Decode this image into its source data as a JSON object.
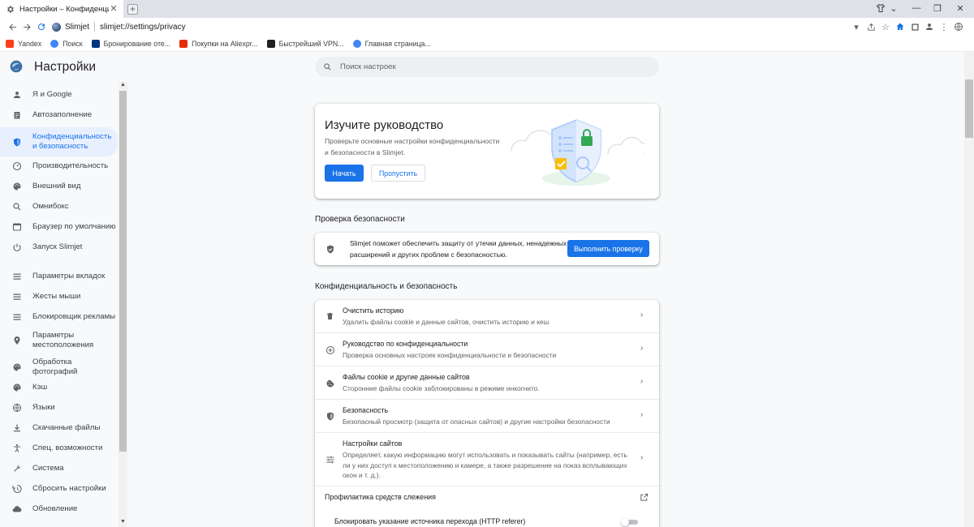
{
  "browser": {
    "tab_title": "Настройки – Конфиденциальность",
    "omnibox": {
      "site": "Slimjet",
      "url": "slimjet://settings/privacy"
    },
    "bookmarks": [
      {
        "label": "Yandex",
        "color": "#fc3f1d"
      },
      {
        "label": "Поиск",
        "color": "#4285f4"
      },
      {
        "label": "Бронирование оте...",
        "color": "#003580"
      },
      {
        "label": "Покупки на Aliexpr...",
        "color": "#e62e04"
      },
      {
        "label": "Быстрейший VPN...",
        "color": "#202124"
      },
      {
        "label": "Главная страница...",
        "color": "#4285f4"
      }
    ]
  },
  "page": {
    "title": "Настройки",
    "search_placeholder": "Поиск настроек"
  },
  "sidebar": {
    "items": [
      {
        "label": "Я и Google",
        "icon": "person-icon"
      },
      {
        "label": "Автозаполнение",
        "icon": "clipboard-icon"
      },
      {
        "label": "Конфиденциальность и безопасность",
        "icon": "shield-icon",
        "active": true
      },
      {
        "label": "Производительность",
        "icon": "speedometer-icon"
      },
      {
        "label": "Внешний вид",
        "icon": "palette-icon"
      },
      {
        "label": "Омнибокс",
        "icon": "search-icon"
      },
      {
        "label": "Браузер по умолчанию",
        "icon": "browser-icon"
      },
      {
        "label": "Запуск Slimjet",
        "icon": "power-icon"
      },
      {
        "label": "Параметры вкладок",
        "icon": "tabs-icon"
      },
      {
        "label": "Жесты мыши",
        "icon": "mouse-icon"
      },
      {
        "label": "Блокировщик рекламы",
        "icon": "block-icon"
      },
      {
        "label": "Параметры местоположения",
        "icon": "location-icon"
      },
      {
        "label": "Обработка фотографий",
        "icon": "photo-icon"
      },
      {
        "label": "Кэш",
        "icon": "cache-icon"
      },
      {
        "label": "Языки",
        "icon": "globe-icon"
      },
      {
        "label": "Скачанные файлы",
        "icon": "download-icon"
      },
      {
        "label": "Спец. возможности",
        "icon": "accessibility-icon"
      },
      {
        "label": "Система",
        "icon": "wrench-icon"
      },
      {
        "label": "Сбросить настройки",
        "icon": "reset-icon"
      },
      {
        "label": "Обновление",
        "icon": "cloud-icon"
      }
    ]
  },
  "promo": {
    "title": "Изучите руководство",
    "description": "Проверьте основные настройки конфиденциальности и безопасности в Slimjet.",
    "start_label": "Начать",
    "skip_label": "Пропустить"
  },
  "safety_check": {
    "section_title": "Проверка безопасности",
    "text": "Slimjet поможет обеспечить защиту от утечки данных, ненадежных расширений и других проблем с безопасностью.",
    "button_label": "Выполнить проверку"
  },
  "privacy": {
    "section_title": "Конфиденциальность и безопасность",
    "rows": [
      {
        "title": "Очистить историю",
        "subtitle": "Удалить файлы cookie и данные сайтов, очистить историю и кеш",
        "icon": "trash-icon"
      },
      {
        "title": "Руководство по конфиденциальности",
        "subtitle": "Проверка основных настроек конфиденциальности и безопасности",
        "icon": "compass-icon"
      },
      {
        "title": "Файлы cookie и другие данные сайтов",
        "subtitle": "Сторонние файлы cookie заблокированы в режиме инкогнито.",
        "icon": "cookie-icon"
      },
      {
        "title": "Безопасность",
        "subtitle": "Безопасный просмотр (защита от опасных сайтов) и другие настройки безопасности",
        "icon": "security-shield-icon"
      },
      {
        "title": "Настройки сайтов",
        "subtitle": "Определяет, какую информацию могут использовать и показывать сайты (например, есть ли у них доступ к местоположению и камере, а также разрешение на показ всплывающих окон и т. д.).",
        "icon": "sliders-icon"
      }
    ],
    "tracking_label": "Профилактика средств слежения",
    "referer_label": "Блокировать указание источника перехода (HTTP referer)",
    "referer_enabled": false
  }
}
